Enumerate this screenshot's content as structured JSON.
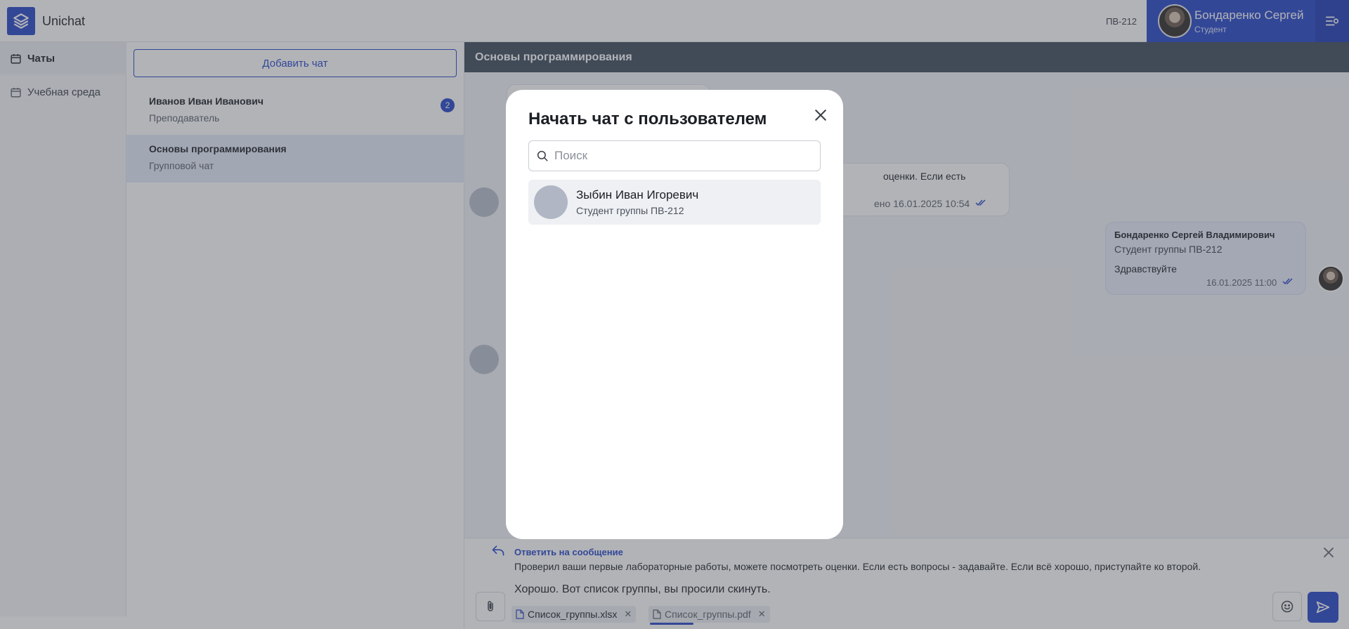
{
  "app": {
    "title": "Unichat"
  },
  "header": {
    "group": "ПВ-212",
    "user": {
      "name": "Бондаренко Сергей",
      "role": "Студент"
    }
  },
  "nav": {
    "items": [
      {
        "label": "Чаты",
        "icon": "calendar-icon"
      },
      {
        "label": "Учебная среда",
        "icon": "calendar-icon"
      }
    ]
  },
  "chat_list": {
    "add_button": "Добавить чат",
    "items": [
      {
        "name": "Иванов Иван Иванович",
        "subtitle": "Преподаватель",
        "unread": "2"
      },
      {
        "name": "Основы программирования",
        "subtitle": "Групповой чат"
      }
    ]
  },
  "chat": {
    "title": "Основы программирования",
    "messages": [
      {
        "text_fragment": "оценки. Если есть",
        "time_fragment": "ено 16.01.2025 10:54"
      },
      {
        "author": "Бондаренко Сергей Владимирович",
        "author_sub": "Студент группы ПВ-212",
        "text": "Здравствуйте",
        "time": "16.01.2025 11:00"
      }
    ]
  },
  "composer": {
    "reply_title": "Ответить на сообщение",
    "reply_text": "Проверил ваши первые лабораторные работы, можете посмотреть оценки. Если есть вопросы - задавайте. Если всё хорошо, приступайте ко второй.",
    "text": "Хорошо. Вот список группы, вы просили скинуть.",
    "attachments": [
      {
        "name": "Список_группы.xlsx"
      },
      {
        "name": "Список_группы.pdf"
      }
    ]
  },
  "modal": {
    "title": "Начать чат с пользователем",
    "search_placeholder": "Поиск",
    "users": [
      {
        "name": "Зыбин Иван Игоревич",
        "subtitle": "Студент группы ПВ-212"
      }
    ]
  },
  "colors": {
    "accent": "#2746c9",
    "header_dark": "#3f4a5a",
    "overlay": "rgba(70,74,84,0.42)"
  }
}
